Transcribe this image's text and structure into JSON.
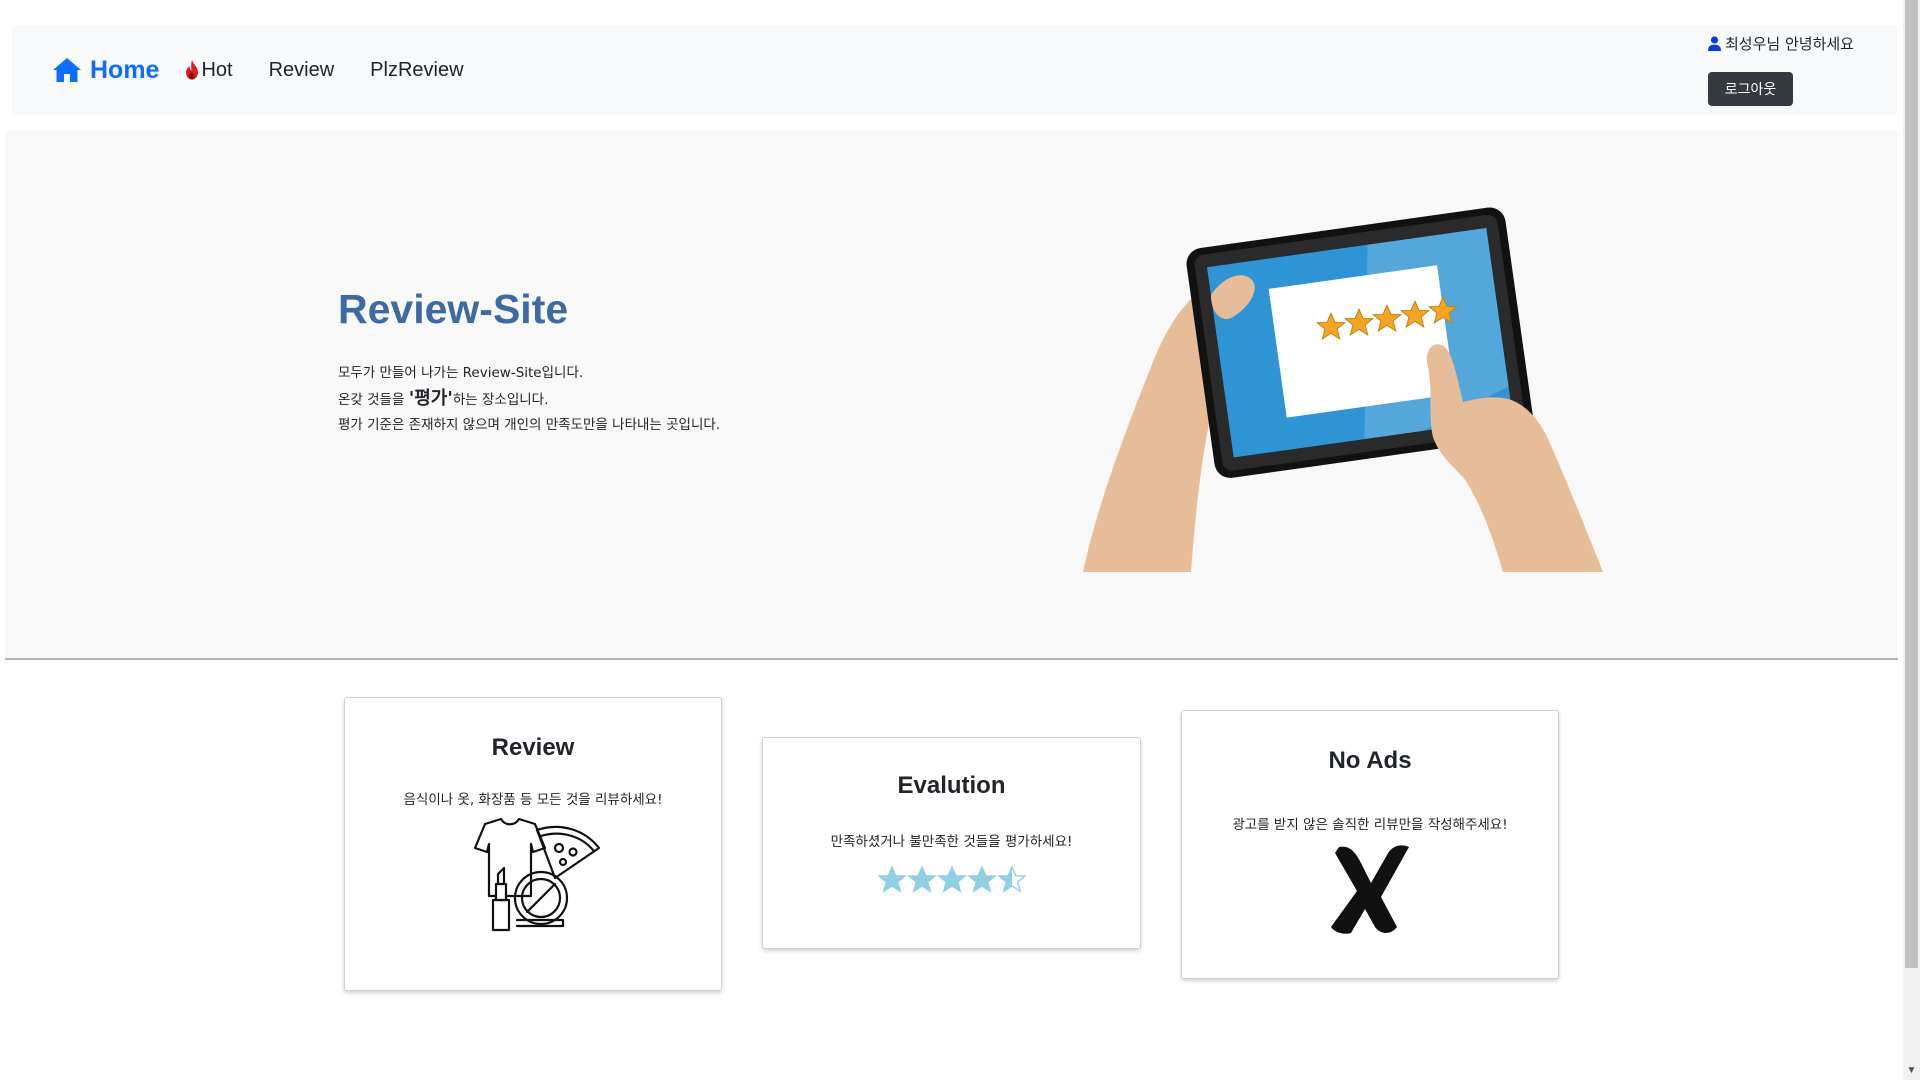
{
  "nav": {
    "home_label": "Home",
    "hot_label": "Hot",
    "review_label": "Review",
    "plzreview_label": "PlzReview",
    "user_greeting": "최성우님 안녕하세요",
    "logout_label": "로그아웃",
    "accent_color": "#0d6efd"
  },
  "hero": {
    "title": "Review-Site",
    "line1": "모두가 만들어 나가는 Review-Site입니다.",
    "line2_prefix": "온갖 것들을 ",
    "line2_emph": "'평가'",
    "line2_suffix": "하는 장소입니다.",
    "line3": "평가 기준은 존재하지 않으며 개인의 만족도만을 나타내는 곳입니다.",
    "title_color": "#3d6aa1"
  },
  "cards": {
    "review": {
      "title": "Review",
      "description": "음식이나 옷, 화장품 등 모든 것을 리뷰하세요!",
      "icon": "products-icon"
    },
    "evaluation": {
      "title": "Evalution",
      "description": "만족하셨거나 불만족한 것들을 평가하세요!",
      "rating": 4.5,
      "rating_max": 5,
      "star_color": "#8fd0e6"
    },
    "noads": {
      "title": "No Ads",
      "description": "광고를 받지 않은 솔직한 리뷰만을 작성해주세요!",
      "icon": "x-mark-icon"
    }
  }
}
